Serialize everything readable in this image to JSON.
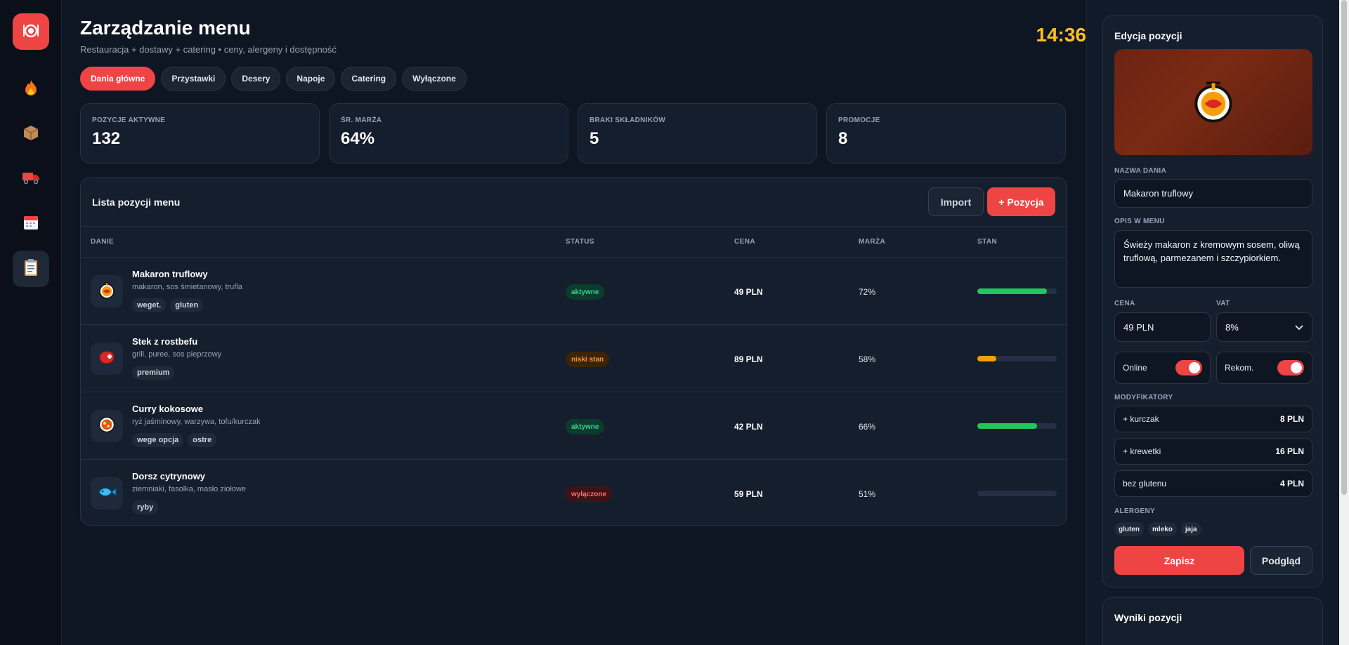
{
  "rail": {
    "logo_icon": "plate-icon",
    "items": [
      {
        "icon": "fire-icon",
        "active": false
      },
      {
        "icon": "box-icon",
        "active": false
      },
      {
        "icon": "truck-icon",
        "active": false
      },
      {
        "icon": "calendar-icon",
        "active": false
      },
      {
        "icon": "clipboard-icon",
        "active": true
      }
    ]
  },
  "header": {
    "title": "Zarządzanie menu",
    "subtitle": "Restauracja + dostawy + catering • ceny, alergeny i dostępność",
    "clock": "14:36"
  },
  "tabs": [
    {
      "label": "Dania główne",
      "active": true
    },
    {
      "label": "Przystawki",
      "active": false
    },
    {
      "label": "Desery",
      "active": false
    },
    {
      "label": "Napoje",
      "active": false
    },
    {
      "label": "Catering",
      "active": false
    },
    {
      "label": "Wyłączone",
      "active": false
    }
  ],
  "stats": [
    {
      "label": "POZYCJE AKTYWNE",
      "value": "132"
    },
    {
      "label": "ŚR. MARŻA",
      "value": "64%"
    },
    {
      "label": "BRAKI SKŁADNIKÓW",
      "value": "5"
    },
    {
      "label": "PROMOCJE",
      "value": "8"
    }
  ],
  "list": {
    "title": "Lista pozycji menu",
    "import_label": "Import",
    "add_label": "+ Pozycja",
    "columns": [
      "DANIE",
      "STATUS",
      "CENA",
      "MARŻA",
      "STAN"
    ],
    "rows": [
      {
        "name": "Makaron truflowy",
        "desc": "makaron, sos śmietanowy, trufla",
        "tags": [
          "weget.",
          "gluten"
        ],
        "status": "aktywne",
        "status_color": "#34d399",
        "price": "49 PLN",
        "margin": "72%",
        "stock": 0.88,
        "stock_color": "#22c55e",
        "icon": "pasta-icon"
      },
      {
        "name": "Stek z rostbefu",
        "desc": "grill, puree, sos pieprzowy",
        "tags": [
          "premium"
        ],
        "status": "niski stan",
        "status_color": "#fb923c",
        "price": "89 PLN",
        "margin": "58%",
        "stock": 0.24,
        "stock_color": "#f59e0b",
        "icon": "steak-icon"
      },
      {
        "name": "Curry kokosowe",
        "desc": "ryż jaśminowy, warzywa, tofu/kurczak",
        "tags": [
          "wege opcja",
          "ostre"
        ],
        "status": "aktywne",
        "status_color": "#34d399",
        "price": "42 PLN",
        "margin": "66%",
        "stock": 0.75,
        "stock_color": "#22c55e",
        "icon": "curry-icon"
      },
      {
        "name": "Dorsz cytrynowy",
        "desc": "ziemniaki, fasolka, masło ziołowe",
        "tags": [
          "ryby"
        ],
        "status": "wyłączone",
        "status_color": "#f87171",
        "price": "59 PLN",
        "margin": "51%",
        "stock": 0,
        "stock_color": "#64748b",
        "icon": "fish-icon"
      }
    ]
  },
  "editor": {
    "title": "Edycja pozycji",
    "image_icon": "pasta-icon",
    "name_label": "NAZWA DANIA",
    "name_value": "Makaron truflowy",
    "desc_label": "OPIS W MENU",
    "desc_value": "Świeży makaron z kremowym sosem, oliwą truflową, parmezanem i szczypiorkiem.",
    "price_label": "CENA",
    "price_value": "49 PLN",
    "vat_label": "VAT",
    "vat_value": "8%",
    "online_label": "Online",
    "online_on": true,
    "recommend_label": "Rekom.",
    "recommend_on": true,
    "modifiers_label": "MODYFIKATORY",
    "modifiers": [
      {
        "name": "+ kurczak",
        "price": "8 PLN"
      },
      {
        "name": "+ krewetki",
        "price": "16 PLN"
      },
      {
        "name": "bez glutenu",
        "price": "4 PLN"
      }
    ],
    "allergens_label": "ALERGENY",
    "allergens": [
      "gluten",
      "mleko",
      "jaja"
    ],
    "save_label": "Zapisz",
    "preview_label": "Podgląd"
  },
  "results": {
    "title": "Wyniki pozycji"
  }
}
